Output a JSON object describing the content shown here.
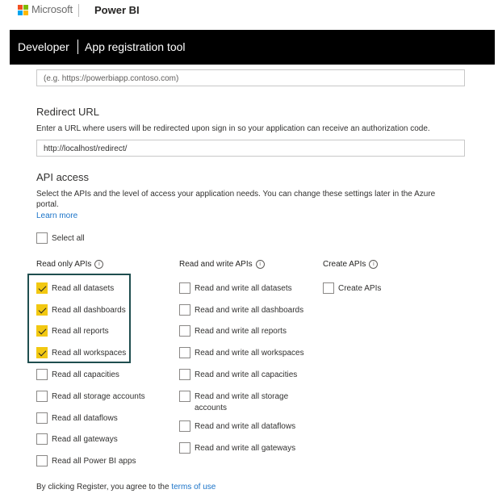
{
  "header": {
    "company": "Microsoft",
    "product": "Power BI",
    "logo_colors": [
      "#f25022",
      "#7fba00",
      "#00a4ef",
      "#ffb900"
    ]
  },
  "appbar": {
    "section": "Developer",
    "tool": "App registration tool"
  },
  "home_url": {
    "placeholder": "(e.g. https://powerbiapp.contoso.com)"
  },
  "redirect": {
    "title": "Redirect URL",
    "description": "Enter a URL where users will be redirected upon sign in so your application can receive an authorization code.",
    "value": "http://localhost/redirect/"
  },
  "api_access": {
    "title": "API access",
    "description_line1": "Select the APIs and the level of access your application needs. You can change these settings later in the Azure",
    "description_line2": "portal.",
    "learn_more": "Learn more",
    "select_all": "Select all"
  },
  "columns": {
    "read_only": {
      "header": "Read only APIs",
      "items": [
        {
          "label": "Read all datasets",
          "checked": true
        },
        {
          "label": "Read all dashboards",
          "checked": true
        },
        {
          "label": "Read all reports",
          "checked": true
        },
        {
          "label": "Read all workspaces",
          "checked": true
        },
        {
          "label": "Read all capacities",
          "checked": false
        },
        {
          "label": "Read all storage accounts",
          "checked": false
        },
        {
          "label": "Read all dataflows",
          "checked": false
        },
        {
          "label": "Read all gateways",
          "checked": false
        },
        {
          "label": "Read all Power BI apps",
          "checked": false
        }
      ]
    },
    "read_write": {
      "header": "Read and write APIs",
      "items": [
        {
          "label": "Read and write all datasets",
          "checked": false
        },
        {
          "label": "Read and write all dashboards",
          "checked": false
        },
        {
          "label": "Read and write all reports",
          "checked": false
        },
        {
          "label": "Read and write all workspaces",
          "checked": false
        },
        {
          "label": "Read and write all capacities",
          "checked": false
        },
        {
          "label_line1": "Read and write all storage",
          "label_line2": "accounts",
          "checked": false
        },
        {
          "label": "Read and write all dataflows",
          "checked": false
        },
        {
          "label": "Read and write all gateways",
          "checked": false
        }
      ]
    },
    "create": {
      "header": "Create APIs",
      "items": [
        {
          "label": "Create APIs",
          "checked": false
        }
      ]
    }
  },
  "footer": {
    "text": "By clicking Register, you agree to the ",
    "link": "terms of use"
  }
}
